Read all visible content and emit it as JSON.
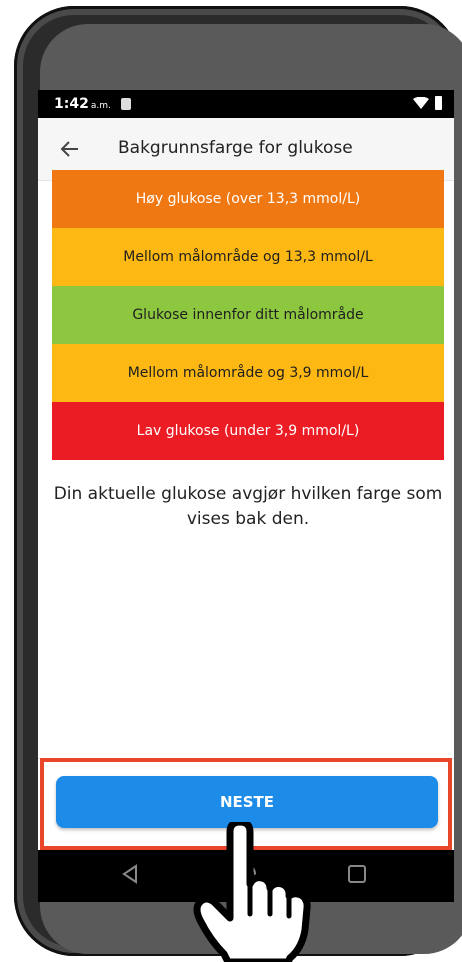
{
  "status_bar": {
    "time": "1:42",
    "ampm": "a.m."
  },
  "app_bar": {
    "title": "Bakgrunnsfarge for glukose"
  },
  "bands": [
    {
      "label": "Høy glukose (over 13,3 mmol/L)",
      "color": "#f07812",
      "text_color": "#ffffff"
    },
    {
      "label": "Mellom målområde og 13,3 mmol/L",
      "color": "#fdb814",
      "text_color": "#1f1f1f"
    },
    {
      "label": "Glukose innenfor ditt målområde",
      "color": "#8dc740",
      "text_color": "#1f1f1f"
    },
    {
      "label": "Mellom målområde og 3,9 mmol/L",
      "color": "#fdb814",
      "text_color": "#1f1f1f"
    },
    {
      "label": "Lav glukose (under 3,9 mmol/L)",
      "color": "#ec1c24",
      "text_color": "#ffffff"
    }
  ],
  "description": "Din aktuelle glukose avgjør hvilken farge som vises bak den.",
  "next_button": {
    "label": "NESTE"
  },
  "colors": {
    "accent": "#1c8ce8",
    "highlight": "#e8472a"
  }
}
